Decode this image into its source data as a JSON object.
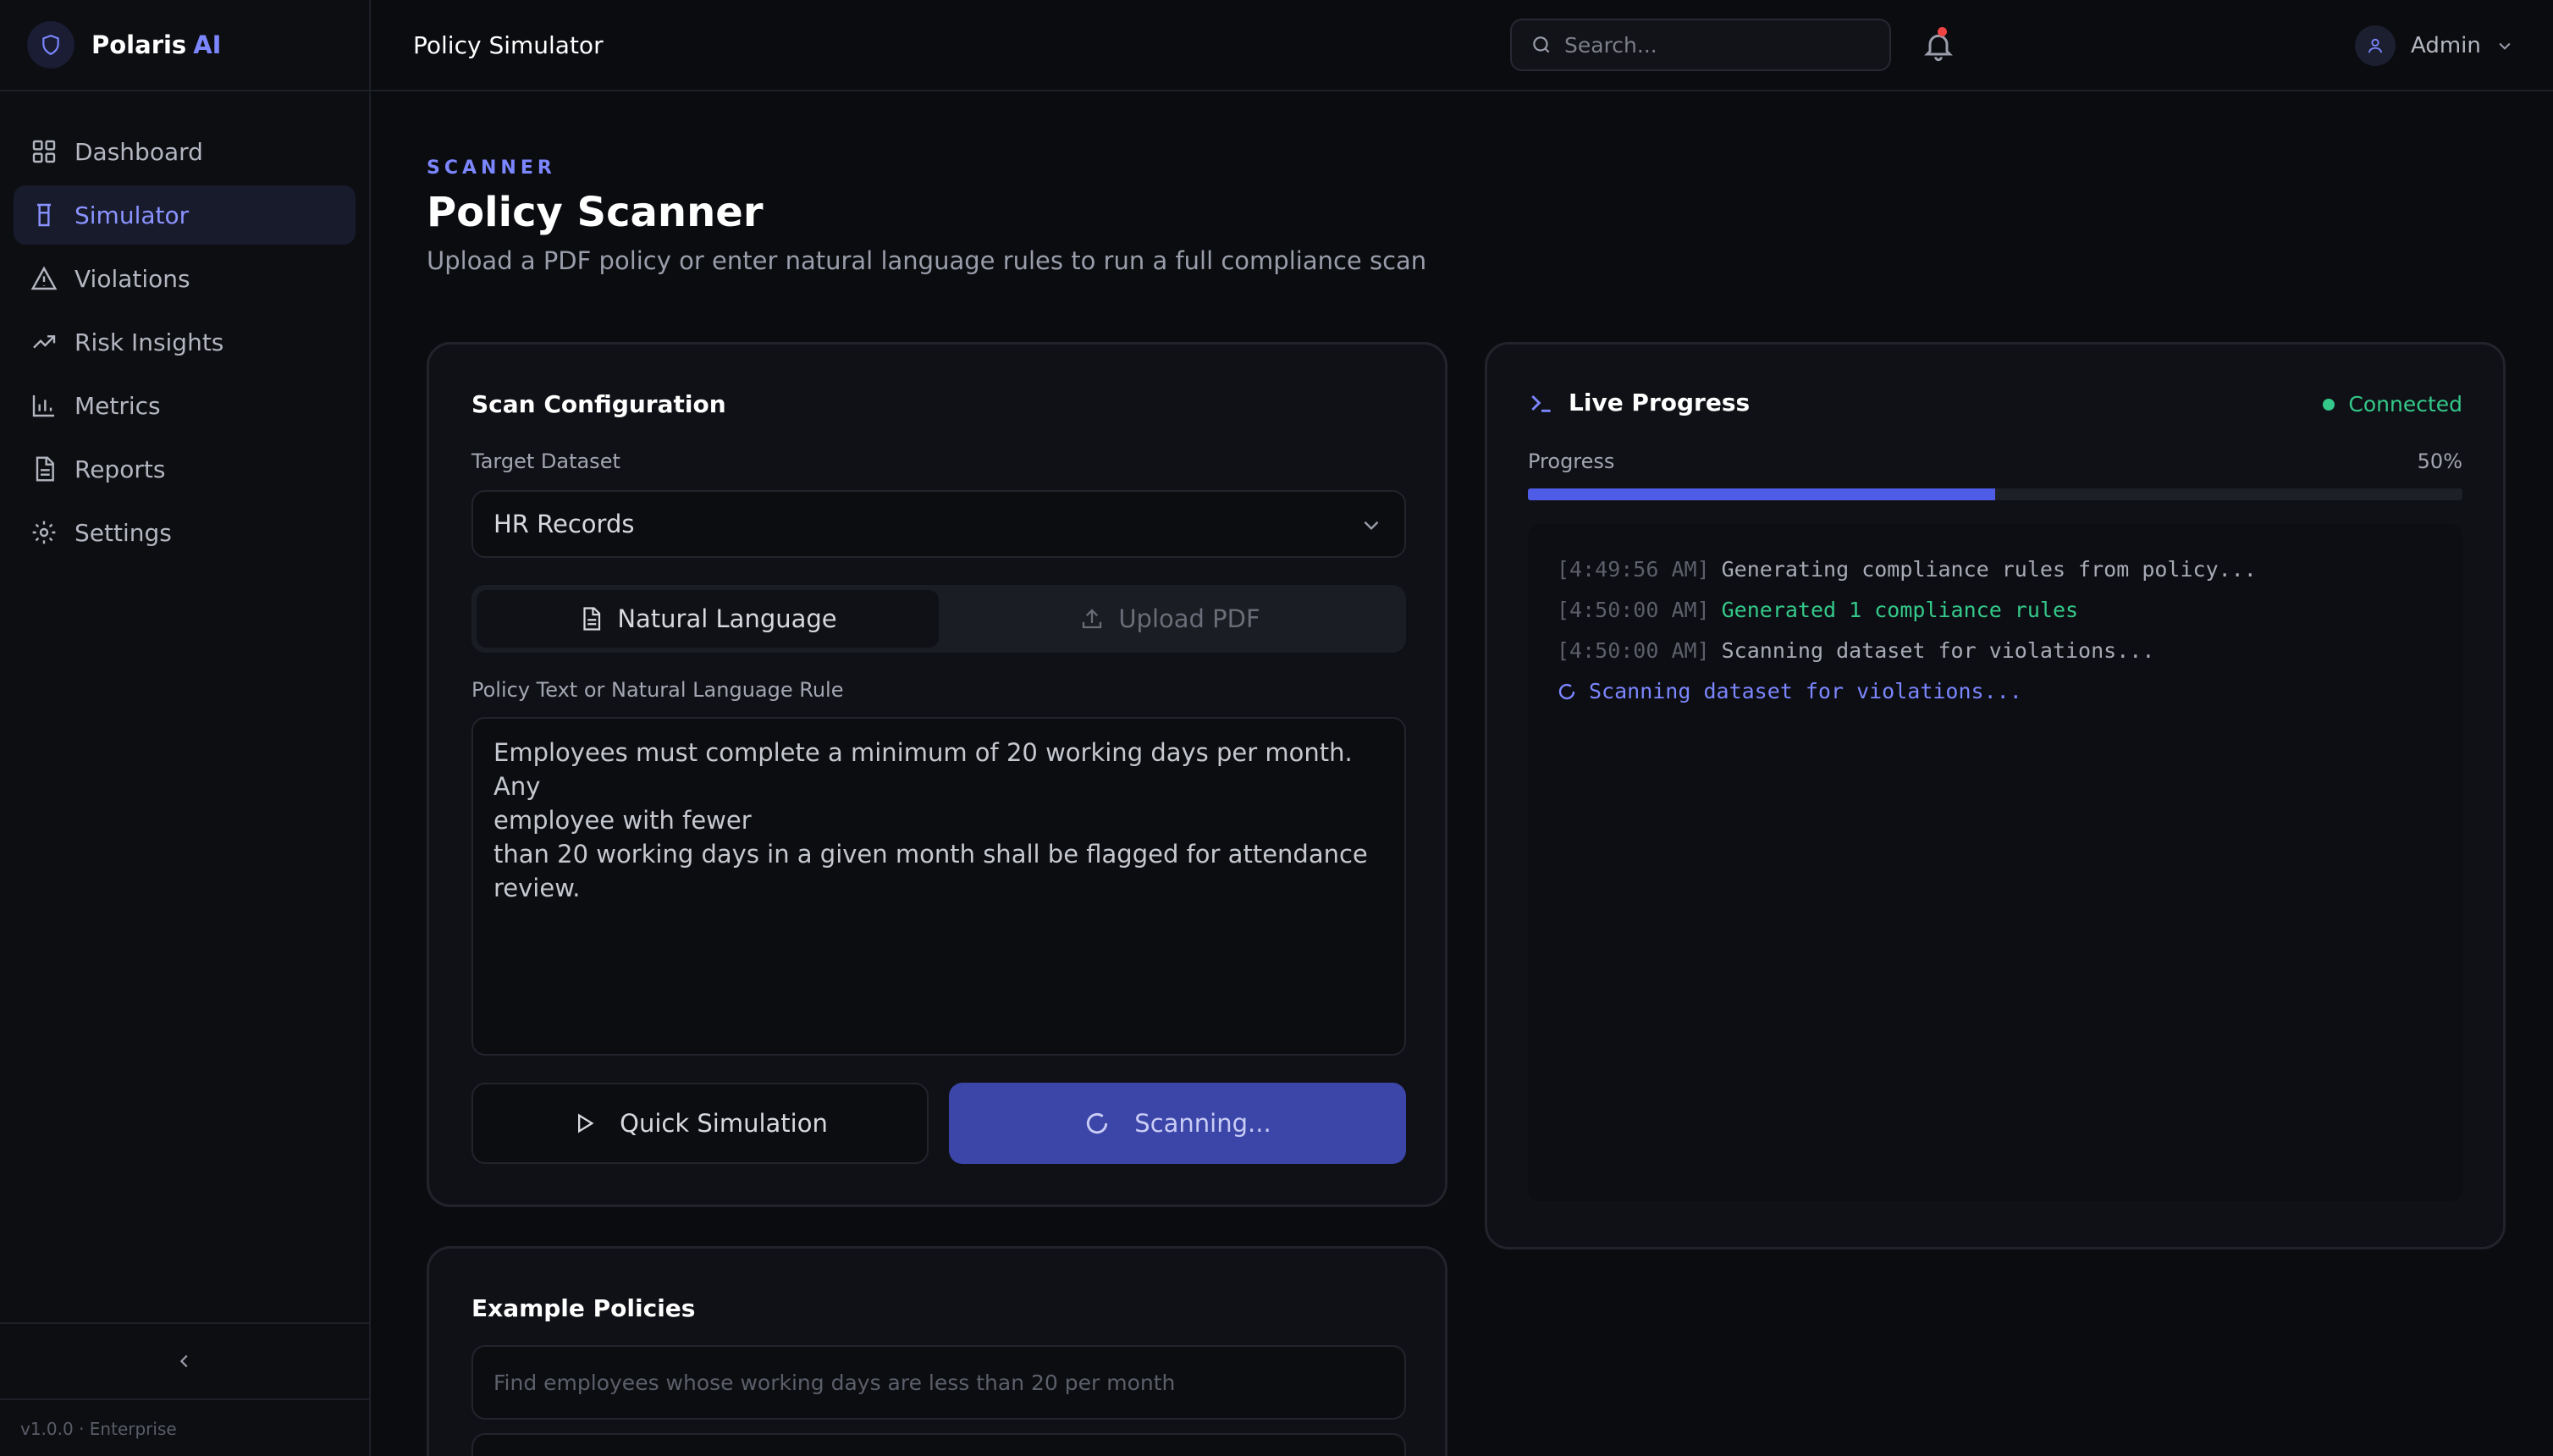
{
  "brand": {
    "name": "Polaris",
    "accent": "AI"
  },
  "sidebar": {
    "items": [
      {
        "label": "Dashboard",
        "icon": "grid-icon"
      },
      {
        "label": "Simulator",
        "icon": "flask-icon",
        "active": true
      },
      {
        "label": "Violations",
        "icon": "warning-icon"
      },
      {
        "label": "Risk Insights",
        "icon": "trending-up-icon"
      },
      {
        "label": "Metrics",
        "icon": "bar-chart-icon"
      },
      {
        "label": "Reports",
        "icon": "document-icon"
      },
      {
        "label": "Settings",
        "icon": "gear-icon"
      }
    ],
    "version": "v1.0.0 · Enterprise"
  },
  "topbar": {
    "title": "Policy Simulator",
    "search_placeholder": "Search...",
    "user": "Admin"
  },
  "page": {
    "eyebrow": "SCANNER",
    "title": "Policy Scanner",
    "subtitle": "Upload a PDF policy or enter natural language rules to run a full compliance scan"
  },
  "scan_config": {
    "title": "Scan Configuration",
    "dataset_label": "Target Dataset",
    "dataset_value": "HR Records",
    "tab_natural": "Natural Language",
    "tab_pdf": "Upload PDF",
    "policy_label": "Policy Text or Natural Language Rule",
    "policy_line1": "Employees must complete a minimum of 20 working days per month. Any",
    "policy_line2": "employee with fewer",
    "policy_line3": "than 20 working days in a given month shall be flagged for attendance review.",
    "quick_sim": "Quick Simulation",
    "scanning": "Scanning..."
  },
  "live_progress": {
    "title": "Live Progress",
    "status": "Connected",
    "progress_label": "Progress",
    "progress_text": "50%",
    "progress_value": 50,
    "log": [
      {
        "ts": "[4:49:56 AM]",
        "msg": "Generating compliance rules from policy..."
      },
      {
        "ts": "[4:50:00 AM]",
        "msg": "Generated 1 compliance rules"
      },
      {
        "ts": "[4:50:00 AM]",
        "msg": "Scanning dataset for violations..."
      },
      {
        "msg": "Scanning dataset for violations..."
      }
    ]
  },
  "examples": {
    "title": "Example Policies",
    "item1": "Find employees whose working days are less than 20 per month"
  },
  "colors": {
    "accent": "#7b86ff",
    "success": "#34c98a",
    "primary_button": "#3b46a8",
    "progress": "#4f5ce8"
  }
}
